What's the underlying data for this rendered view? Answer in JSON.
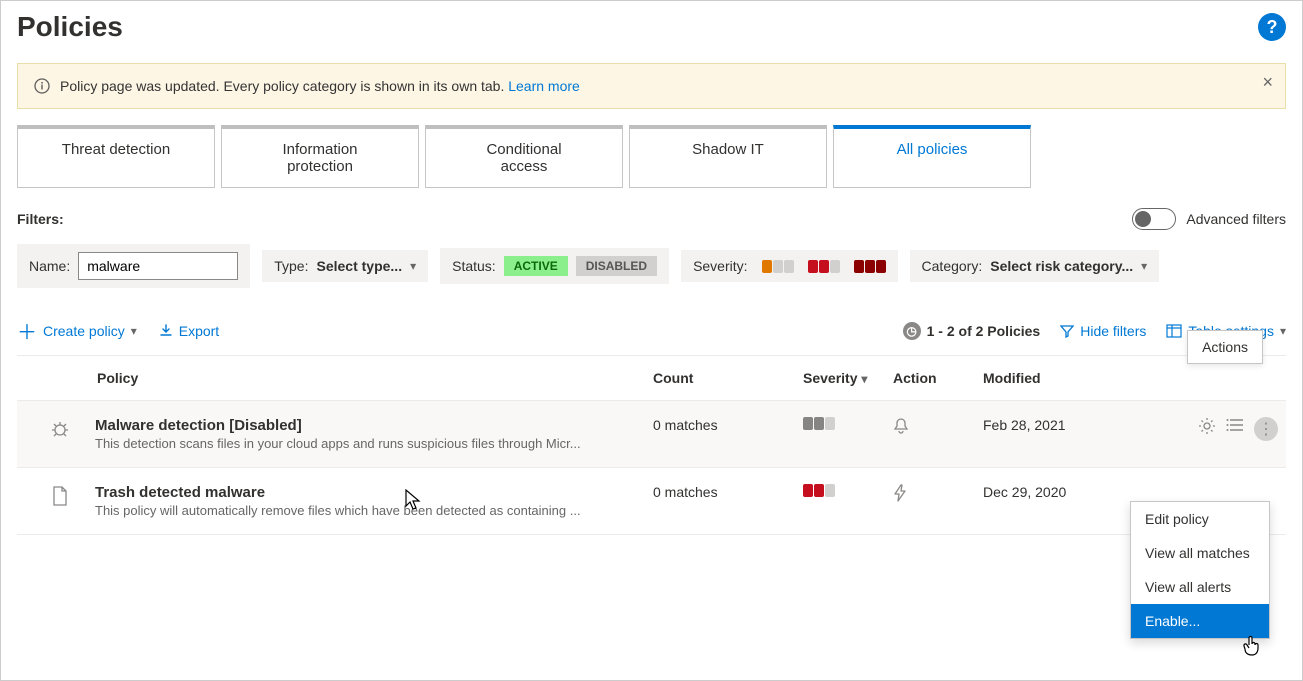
{
  "page_title": "Policies",
  "banner": {
    "text": "Policy page was updated. Every policy category is shown in its own tab. ",
    "link": "Learn more"
  },
  "tabs": [
    {
      "label": "Threat detection"
    },
    {
      "label": "Information protection"
    },
    {
      "label": "Conditional access"
    },
    {
      "label": "Shadow IT"
    },
    {
      "label": "All policies"
    }
  ],
  "filters_label": "Filters:",
  "advanced_filters_label": "Advanced filters",
  "filter_name_label": "Name:",
  "filter_name_value": "malware",
  "filter_type_label": "Type:",
  "filter_type_value": "Select type...",
  "filter_status_label": "Status:",
  "status_active": "ACTIVE",
  "status_disabled": "DISABLED",
  "filter_severity_label": "Severity:",
  "filter_category_label": "Category:",
  "filter_category_value": "Select risk category...",
  "toolbar": {
    "create_policy": "Create policy",
    "export": "Export",
    "count_text": "1 - 2 of 2 Policies",
    "hide_filters": "Hide filters",
    "table_settings": "Table settings"
  },
  "columns": {
    "policy": "Policy",
    "count": "Count",
    "severity": "Severity",
    "action": "Action",
    "modified": "Modified",
    "actions": "Actions"
  },
  "rows": [
    {
      "name": "Malware detection [Disabled]",
      "desc": "This detection scans files in your cloud apps and runs suspicious files through Micr...",
      "count": "0 matches",
      "severity": "low-grey",
      "modified": "Feb 28, 2021",
      "icon": "bug"
    },
    {
      "name": "Trash detected malware",
      "desc": "This policy will automatically remove files which have been detected as containing ...",
      "count": "0 matches",
      "severity": "medium-red",
      "modified": "Dec 29, 2020",
      "icon": "file"
    }
  ],
  "context_menu": {
    "edit": "Edit policy",
    "matches": "View all matches",
    "alerts": "View all alerts",
    "enable": "Enable..."
  }
}
